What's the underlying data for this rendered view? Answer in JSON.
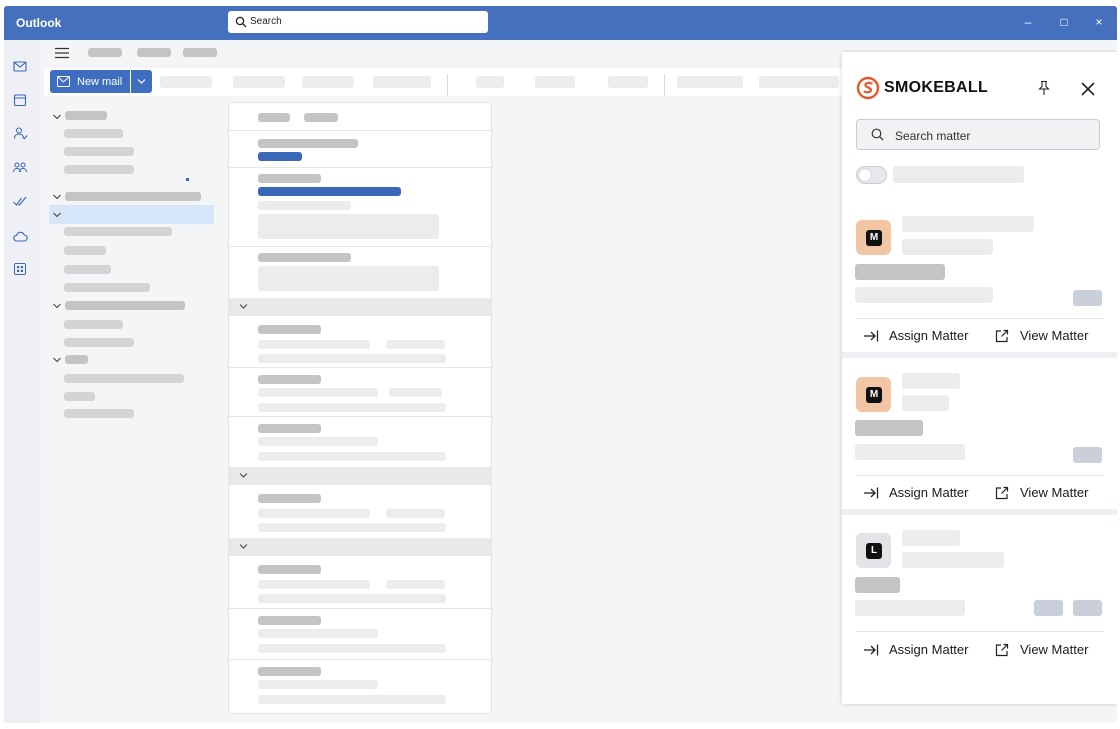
{
  "window": {
    "app_title": "Outlook",
    "search_placeholder": "Search",
    "controls": {
      "minimize": "–",
      "maximize": "□",
      "close": "×"
    }
  },
  "rail_icons": [
    "mail-icon",
    "calendar-icon",
    "people-icon",
    "groups-icon",
    "todo-icon",
    "cloud-icon",
    "apps-icon"
  ],
  "toolbar": {
    "new_mail_label": "New mail"
  },
  "colors": {
    "titlebar": "#4470be",
    "accent": "#3f6ec0",
    "smokeball_brand": "#e8562a",
    "matter_avatar_peach": "#f2c6a4",
    "matter_avatar_gray": "#e3e4e8"
  },
  "smokeball": {
    "brand_name": "SMOKEBALL",
    "search_placeholder": "Search matter",
    "matters": [
      {
        "initial": "M",
        "assign_label": "Assign Matter",
        "view_label": "View Matter"
      },
      {
        "initial": "M",
        "assign_label": "Assign Matter",
        "view_label": "View Matter"
      },
      {
        "initial": "L",
        "assign_label": "Assign Matter",
        "view_label": "View Matter"
      }
    ]
  }
}
